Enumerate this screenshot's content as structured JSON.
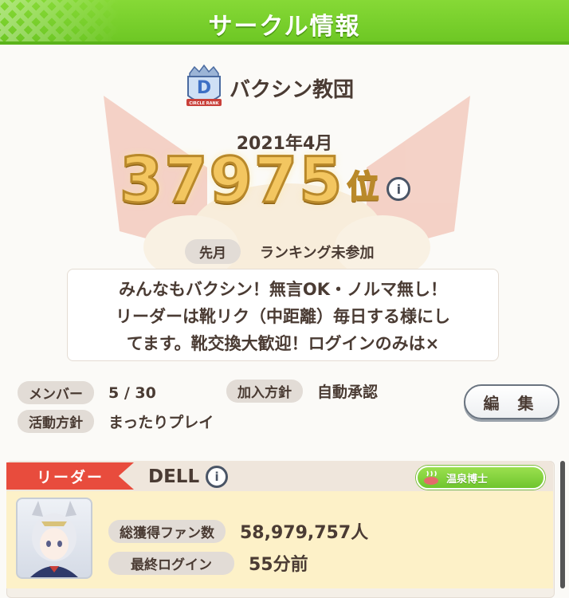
{
  "header": {
    "title": "サークル情報"
  },
  "circle": {
    "name": "バクシン教団",
    "badge_letter": "D",
    "badge_caption": "CIRCLE RANK"
  },
  "ranking": {
    "month": "2021年4月",
    "rank": "37975",
    "unit": "位",
    "info_icon": "i"
  },
  "last_month": {
    "label": "先月",
    "value": "ランキング未参加"
  },
  "message": {
    "lines": [
      "みんなもバクシン！無言OK・ノルマ無し！",
      "リーダーは靴リク（中距離）毎日する様にし",
      "てます。靴交換大歓迎！ログインのみは×"
    ]
  },
  "details": {
    "members_label": "メンバー",
    "members_value": "5 / 30",
    "join_label": "加入方針",
    "join_value": "自動承認",
    "activity_label": "活動方針",
    "activity_value": "まったりプレイ"
  },
  "edit_button": {
    "label": "編 集"
  },
  "leader": {
    "tag": "リーダー",
    "name": "DELL",
    "info_icon": "i",
    "title_badge": "温泉博士",
    "fans_label": "総獲得ファン数",
    "fans_value": "58,979,757人",
    "login_label": "最終ログイン",
    "login_value": "55分前"
  },
  "colors": {
    "header_green": "#7acf2c",
    "rank_gold": "#f3c660",
    "leader_red": "#e84c3d",
    "text_dark": "#4a3b33"
  }
}
